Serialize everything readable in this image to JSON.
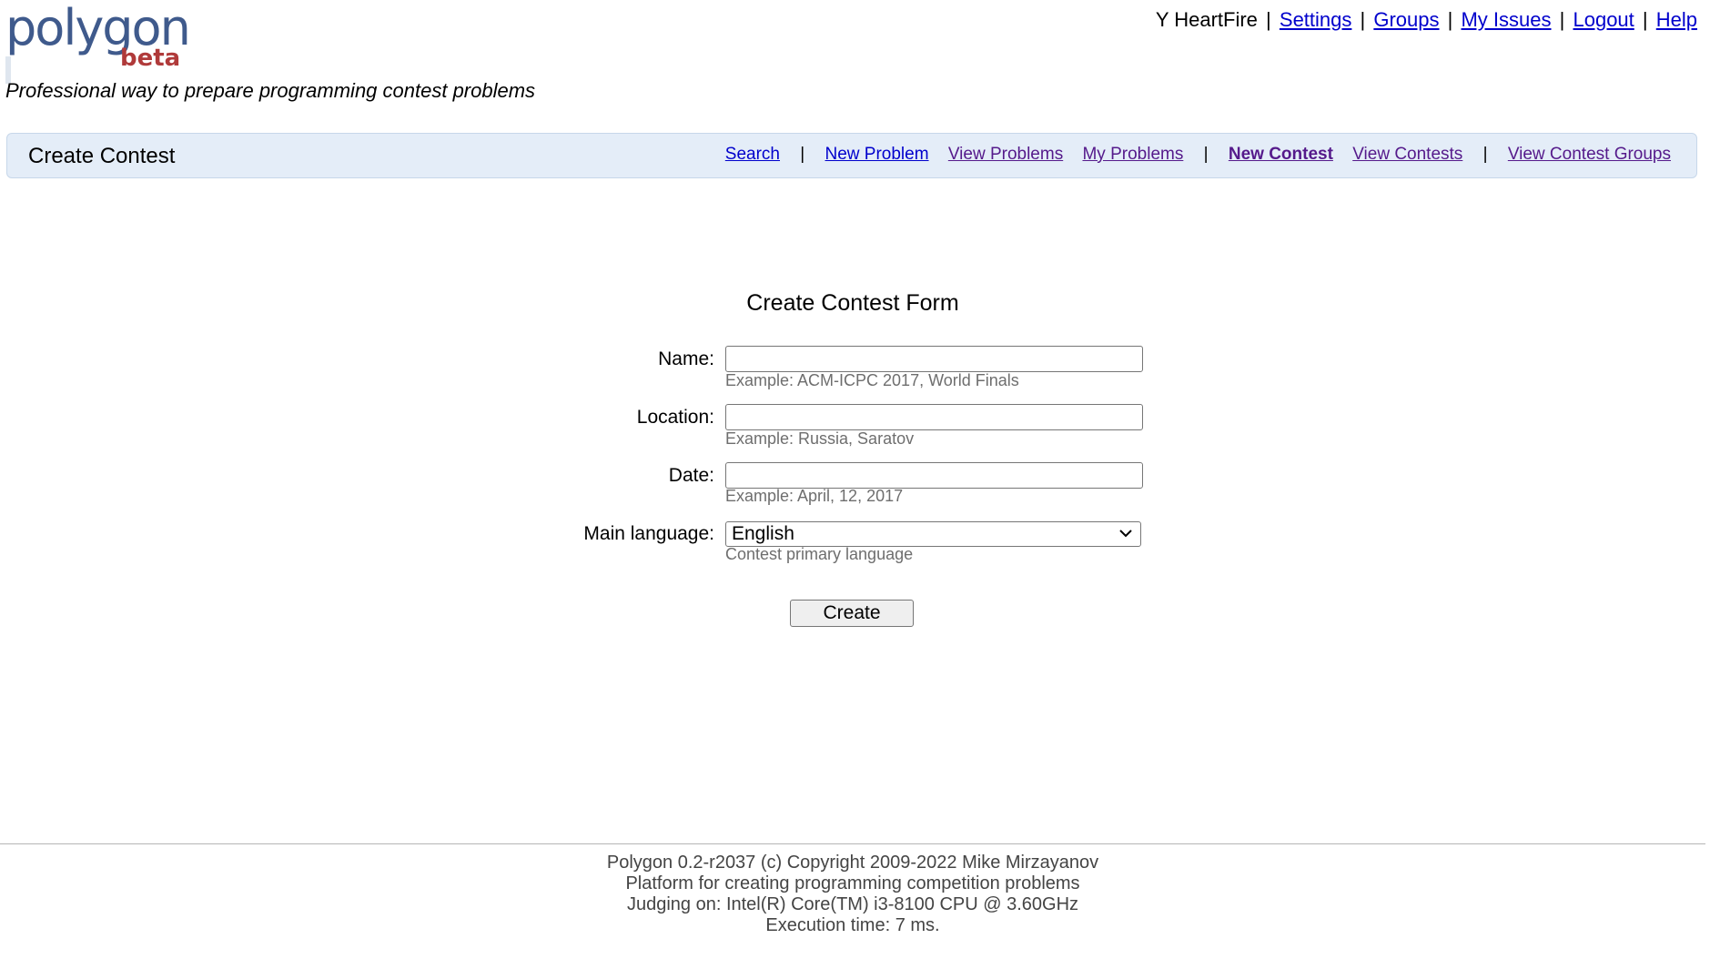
{
  "header": {
    "logo_text": "polygon",
    "logo_badge": "beta",
    "tagline": "Professional way to prepare programming contest problems",
    "user_name": "Y HeartFire",
    "links": [
      "Settings",
      "Groups",
      "My Issues",
      "Logout",
      "Help"
    ]
  },
  "navbar": {
    "title": "Create Contest",
    "links": {
      "search": "Search",
      "new_problem": "New Problem",
      "view_problems": "View Problems",
      "my_problems": "My Problems",
      "new_contest": "New Contest",
      "view_contests": "View Contests",
      "view_contest_groups": "View Contest Groups"
    },
    "separator": "|"
  },
  "form": {
    "title": "Create Contest Form",
    "name": {
      "label": "Name:",
      "value": "",
      "hint": "Example: ACM-ICPC 2017, World Finals"
    },
    "location": {
      "label": "Location:",
      "value": "",
      "hint": "Example: Russia, Saratov"
    },
    "date": {
      "label": "Date:",
      "value": "",
      "hint": "Example: April, 12, 2017"
    },
    "main_language": {
      "label": "Main language:",
      "selected": "English",
      "hint": "Contest primary language"
    },
    "submit_label": "Create"
  },
  "footer": {
    "line1": "Polygon 0.2-r2037 (c) Copyright 2009-2022 Mike Mirzayanov",
    "line2": "Platform for creating programming competition problems",
    "line3": "Judging on: Intel(R) Core(TM) i3-8100 CPU @ 3.60GHz",
    "line4": "Execution time: 7 ms."
  },
  "colors": {
    "navbar_bg": "#e4edf8",
    "link": "#0000cc",
    "visited_link": "#551a8b",
    "logo": "#3f5a8c",
    "logo_badge": "#b03a3a"
  },
  "icons": [
    "chevron-down-icon"
  ]
}
